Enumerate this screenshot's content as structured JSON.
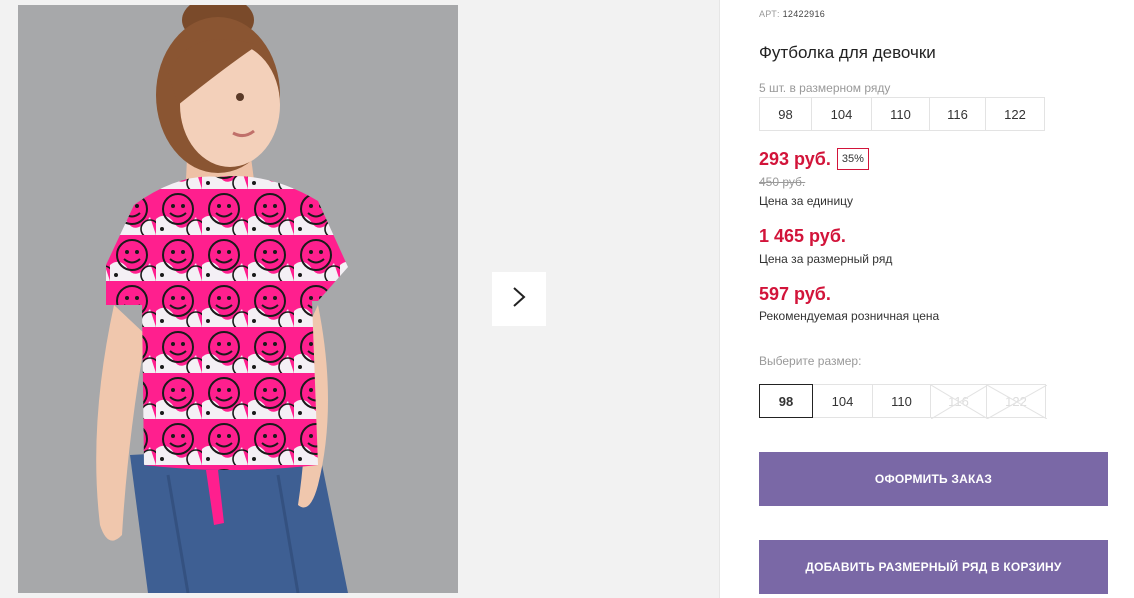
{
  "product": {
    "sku_label": "АРТ:",
    "sku": "12422916",
    "title": "Футболка для девочки",
    "row_count_text": "5 шт. в размерном ряду",
    "row_sizes": [
      "98",
      "104",
      "110",
      "116",
      "122"
    ]
  },
  "prices": {
    "unit_price": "293 руб.",
    "discount": "35%",
    "old_price": "450 руб.",
    "unit_caption": "Цена за единицу",
    "row_price": "1 465 руб.",
    "row_caption": "Цена за размерный ряд",
    "retail_price": "597 руб.",
    "retail_caption": "Рекомендуемая розничная цена"
  },
  "size_select": {
    "label": "Выберите размер:",
    "options": [
      {
        "label": "98",
        "state": "selected"
      },
      {
        "label": "104",
        "state": "available"
      },
      {
        "label": "110",
        "state": "available"
      },
      {
        "label": "116",
        "state": "disabled"
      },
      {
        "label": "122",
        "state": "disabled"
      }
    ]
  },
  "actions": {
    "order_label": "ОФОРМИТЬ ЗАКАЗ",
    "add_row_label": "ДОБАВИТЬ РАЗМЕРНЫЙ РЯД В КОРЗИНУ"
  },
  "icons": {
    "gallery_next": "chevron-right-icon"
  },
  "colors": {
    "accent_button": "#7a68a6",
    "price_red": "#d2143a",
    "photo_background": "#a7a8aa",
    "shirt_pink": "#ff1f8e"
  }
}
